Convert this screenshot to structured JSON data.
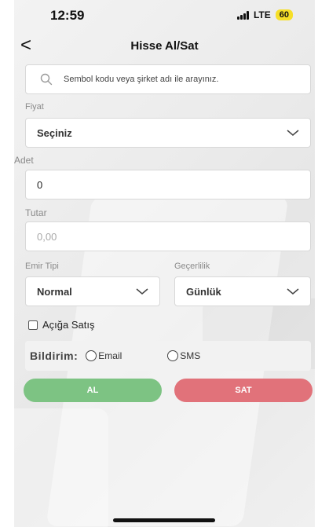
{
  "status": {
    "time": "12:59",
    "network": "LTE",
    "battery": "60",
    "battery_color": "#f6df28"
  },
  "nav": {
    "back_icon": "chevron-left-icon",
    "back_glyph": "<",
    "title": "Hisse Al/Sat"
  },
  "search": {
    "icon": "search-icon",
    "placeholder": "Sembol kodu veya şirket adı ile arayınız."
  },
  "form": {
    "price": {
      "label": "Fiyat",
      "value": "Seçiniz"
    },
    "quantity": {
      "label": "Adet",
      "value": "0"
    },
    "amount": {
      "label": "Tutar",
      "value": "0,00"
    },
    "order_type": {
      "label": "Emir Tipi",
      "value": "Normal"
    },
    "validity": {
      "label": "Geçerlilik",
      "value": "Günlük"
    },
    "short_sell": {
      "label": "Açığa Satış",
      "checked": false
    }
  },
  "notification": {
    "label": "Bildirim:",
    "options": [
      "Email",
      "SMS"
    ]
  },
  "actions": {
    "buy_label": "AL",
    "sell_label": "SAT",
    "buy_color": "#7dc383",
    "sell_color": "#e1727a"
  }
}
